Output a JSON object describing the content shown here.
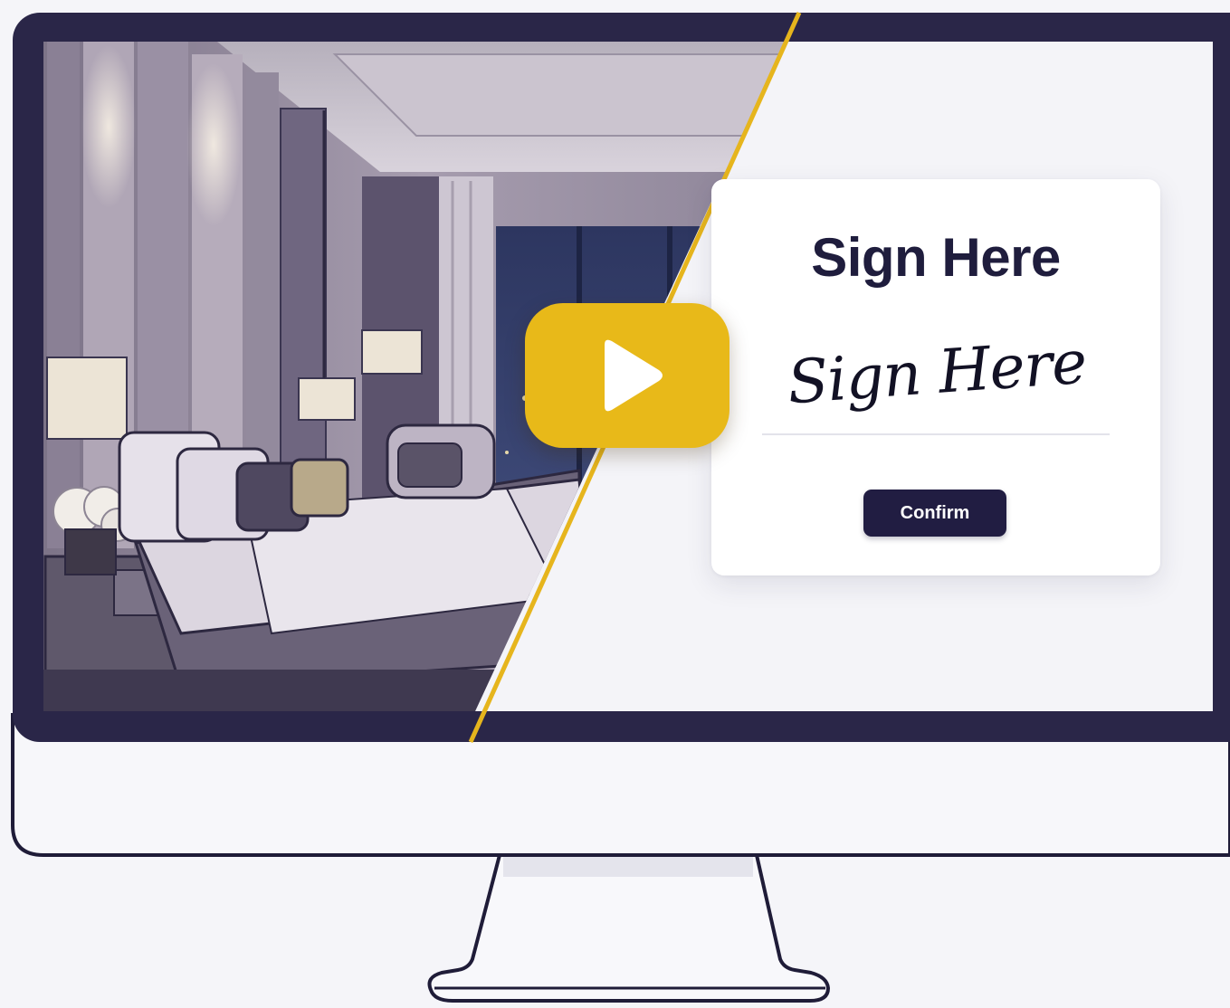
{
  "signature_card": {
    "title": "Sign Here",
    "signature_text": "Sign Here",
    "confirm_label": "Confirm"
  },
  "video": {
    "play_icon": "play-icon"
  },
  "colors": {
    "bezel": "#2a2648",
    "accent_gold": "#e8b919",
    "button_dark": "#211d42",
    "screen_background": "#f5f5f9"
  }
}
